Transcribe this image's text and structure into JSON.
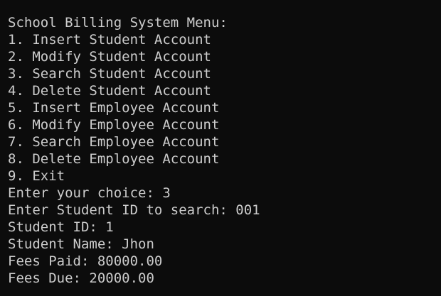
{
  "console": {
    "menu_title": "School Billing System Menu:",
    "menu_items": [
      "1. Insert Student Account",
      "2. Modify Student Account",
      "3. Search Student Account",
      "4. Delete Student Account",
      "5. Insert Employee Account",
      "6. Modify Employee Account",
      "7. Search Employee Account",
      "8. Delete Employee Account",
      "9. Exit"
    ],
    "choice_prompt": "Enter your choice: 3",
    "id_prompt": "Enter Student ID to search: 001",
    "result": {
      "student_id": "Student ID: 1",
      "student_name": "Student Name: Jhon",
      "fees_paid": "Fees Paid: 80000.00",
      "fees_due": "Fees Due: 20000.00"
    },
    "colors": {
      "background": "#0c0c0c",
      "foreground": "#cccccc"
    }
  }
}
